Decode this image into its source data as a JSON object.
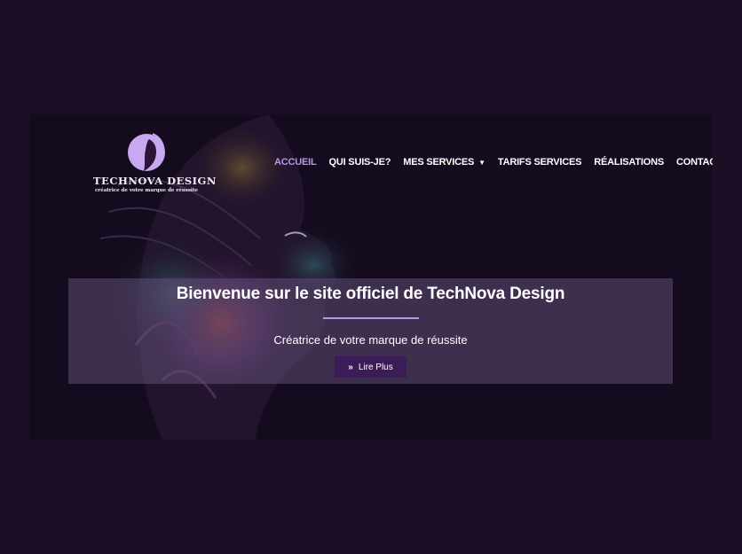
{
  "logo": {
    "name": "TECHNOVA DESIGN",
    "tagline": "créatrice de votre marque de réussite"
  },
  "nav": {
    "items": [
      {
        "label": "ACCUEIL"
      },
      {
        "label": "QUI SUIS-JE?"
      },
      {
        "label": "MES SERVICES",
        "caret": "▼"
      },
      {
        "label": "TARIFS SERVICES"
      },
      {
        "label": "RÉALISATIONS"
      },
      {
        "label": "CONTACT"
      }
    ]
  },
  "hero": {
    "title": "Bienvenue sur le site officiel de TechNova Design",
    "subtitle": "Créatrice de votre marque de réussite",
    "button": {
      "icon": "double-chevron-right-icon",
      "glyph": "»",
      "label": "Lire Plus"
    }
  },
  "colors": {
    "page_background": "#1a0f24",
    "accent": "#b996e6",
    "button": "#3b1c58"
  }
}
